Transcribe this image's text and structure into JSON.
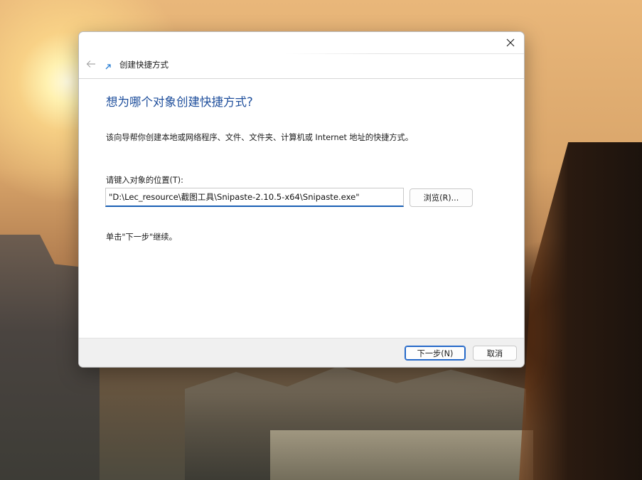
{
  "dialog": {
    "title": "创建快捷方式",
    "heading": "想为哪个对象创建快捷方式?",
    "description": "该向导帮你创建本地或网络程序、文件、文件夹、计算机或 Internet 地址的快捷方式。",
    "location_label": "请键入对象的位置(T):",
    "location_value": "\"D:\\Lec_resource\\截图工具\\Snipaste-2.10.5-x64\\Snipaste.exe\"",
    "browse_label": "浏览(R)...",
    "hint": "单击\"下一步\"继续。",
    "next_label": "下一步(N)",
    "cancel_label": "取消",
    "icons": {
      "close": "close-icon",
      "back": "back-arrow-icon",
      "wizard": "shortcut-wizard-icon"
    },
    "colors": {
      "heading": "#1f4f9c",
      "accent": "#2468c8"
    }
  }
}
